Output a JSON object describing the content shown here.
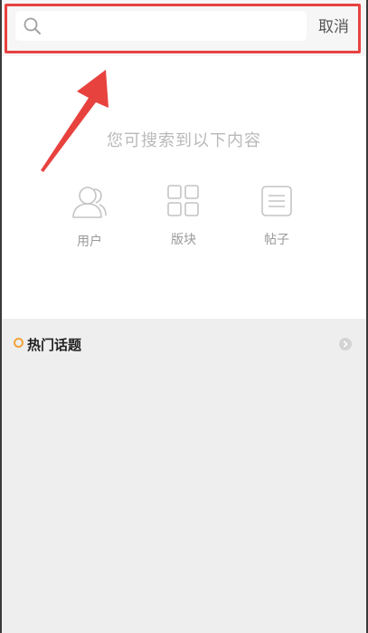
{
  "search": {
    "placeholder": "",
    "value": ""
  },
  "header": {
    "cancel_label": "取消"
  },
  "hint": "您可搜索到以下内容",
  "categories": [
    {
      "label": "用户",
      "icon": "user-icon"
    },
    {
      "label": "版块",
      "icon": "grid-icon"
    },
    {
      "label": "帖子",
      "icon": "post-icon"
    }
  ],
  "hot": {
    "title": "热门话题",
    "icon": "circle-bullet-icon"
  },
  "colors": {
    "highlight": "#e8423f",
    "accent_dot": "#f0a23a",
    "hint_text": "#b9b9b9",
    "section_bg": "#eeeeee"
  }
}
